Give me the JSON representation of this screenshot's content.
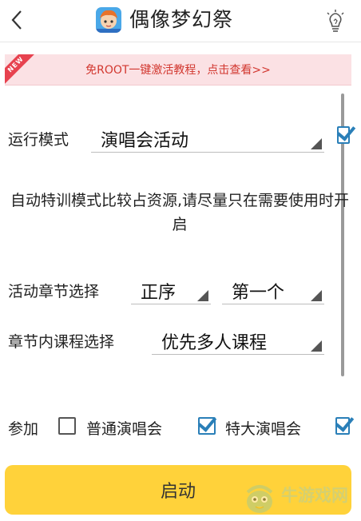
{
  "header": {
    "back_icon": "chevron-left-icon",
    "app_icon": "game-icon",
    "title": "偶像梦幻祭",
    "tip_icon": "lightbulb-icon"
  },
  "banner": {
    "badge": "NEW",
    "text": "免ROOT一键激活教程，点击查看>>"
  },
  "settings": {
    "run_mode_label": "运行模式",
    "run_mode_value": "演唱会活动",
    "hint": "自动特训模式比较占资源,请尽量只在需要使用时开启",
    "chapter_label": "活动章节选择",
    "chapter_order": "正序",
    "chapter_pick": "第一个",
    "course_label": "章节内课程选择",
    "course_value": "优先多人课程"
  },
  "participate": {
    "label": "参加",
    "options": [
      {
        "label": "普通演唱会",
        "checked": false
      },
      {
        "label": "特大演唱会",
        "checked": true
      }
    ]
  },
  "start_button": "启动",
  "watermark": "牛游戏网",
  "colors": {
    "banner_bg": "#fbe1e4",
    "banner_text": "#d2372f",
    "button_bg": "#ffd23a",
    "checkbox_accent": "#2a7fb8"
  }
}
